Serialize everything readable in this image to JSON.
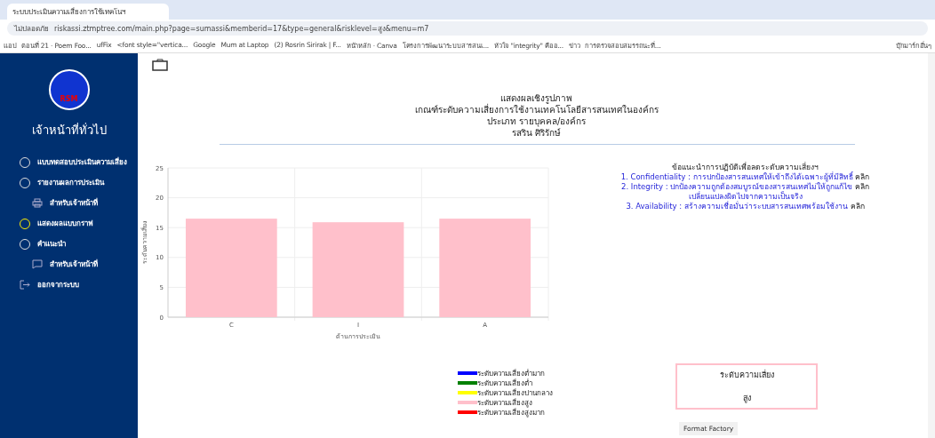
{
  "browser": {
    "tab_title": "ระบบประเมินความเสี่ยงการใช้เทคโนฯ",
    "address": "riskassi.ztmptree.com/main.php?page=sumassi&memberid=17&type=general&risklevel=สูง&menu=m7",
    "security": "ไม่ปลอดภัย",
    "bookmarks": [
      {
        "label": "แอป"
      },
      {
        "label": "ตอนที่ 21 · Poem Foo..."
      },
      {
        "label": "ufFix"
      },
      {
        "label": "<font style=\"vertica..."
      },
      {
        "label": "Google"
      },
      {
        "label": "Mum at Laptop"
      },
      {
        "label": "(2) Rosrin Sirirak | F..."
      },
      {
        "label": "หน้าหลัก · Canva"
      },
      {
        "label": "โครงการพัฒนาระบบสารสนเ..."
      },
      {
        "label": "หัวใจ \"integrity\" คืออ..."
      },
      {
        "label": "ข่าว"
      },
      {
        "label": "การตรวจสอบสมรรถนะที่..."
      }
    ],
    "other_bookmarks": "บุ๊กมาร์กอื่นๆ"
  },
  "sidebar": {
    "logo_text": "RSM",
    "title": "เจ้าหน้าที่ทั่วไป",
    "items": [
      {
        "label": "แบบทดสอบประเมินความเสี่ยง",
        "kind": "circle",
        "selected": false
      },
      {
        "label": "รายงานผลการประเมิน",
        "kind": "circle",
        "selected": false
      },
      {
        "label": "สำหรับเจ้าหน้าที่",
        "kind": "printer",
        "selected": false
      },
      {
        "label": "แสดงผลแบบกราฟ",
        "kind": "circle",
        "selected": true
      },
      {
        "label": "คำแนะนำ",
        "kind": "circle",
        "selected": false
      },
      {
        "label": "สำหรับเจ้าหน้าที่",
        "kind": "chat",
        "selected": false
      },
      {
        "label": "ออกจากระบบ",
        "kind": "logout",
        "selected": false
      }
    ]
  },
  "header": {
    "lines": [
      "แสดงผลเชิงรูปภาพ",
      "เกณฑ์ระดับความเสี่ยงการใช้งานเทคโนโลยีสารสนเทศในองค์กร",
      "ประเภท รายบุคคล/องค์กร",
      "รสริน ศิริรักษ์"
    ]
  },
  "chart": {
    "chart_data": {
      "type": "bar",
      "xlabel": "ด้านการประเมิน",
      "ylabel": "ระดับความเสี่ยง",
      "categories": [
        "C",
        "I",
        "A"
      ],
      "series": [
        {
          "color": "#ffc0cb",
          "values": [
            16.5,
            15.9,
            16.5
          ]
        }
      ],
      "grid": true,
      "ylim": [
        0,
        25
      ],
      "yticks": [
        0,
        5,
        10,
        15,
        20,
        25
      ]
    }
  },
  "advice": {
    "title": "ข้อแนะนำการปฏิบัติเพื่อลดระดับความเสี่ยงฯ",
    "items": [
      {
        "text": "1. Confidentiality : การปกป้องสารสนเทศให้เข้าถึงได้เฉพาะผู้ที่มีสิทธิ์",
        "link": "คลิก"
      },
      {
        "text": "2. Integrity : ปกป้องความถูกต้องสมบูรณ์ของสารสนเทศไม่ให้ถูกแก้ไข",
        "link": "คลิก",
        "extra": "เปลี่ยนแปลงผิดไปจากความเป็นจริง"
      },
      {
        "text": "3. Availability : สร้างความเชื่อมั่นว่าระบบสารสนเทศพร้อมใช้งาน",
        "link": "คลิก"
      }
    ]
  },
  "legend": [
    {
      "label": "ระดับความเสี่ยงต่ำมาก",
      "color": "#0000ff"
    },
    {
      "label": "ระดับความเสี่ยงต่ำ",
      "color": "#008000"
    },
    {
      "label": "ระดับความเสี่ยงปานกลาง",
      "color": "#ffff00"
    },
    {
      "label": "ระดับความเสี่ยงสูง",
      "color": "#ffc0cb"
    },
    {
      "label": "ระดับความเสี่ยงสูงมาก",
      "color": "#ff0000"
    }
  ],
  "risk_box": {
    "title": "ระดับความเสี่ยง",
    "value": "สูง",
    "color": "#ffc0cb"
  },
  "format_button": "Format Factory"
}
